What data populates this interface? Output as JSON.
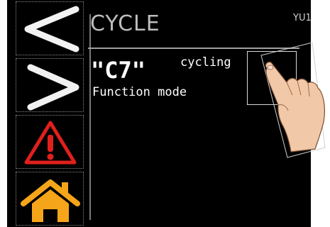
{
  "screen": {
    "title": "CYCLE",
    "code": "YU1",
    "alarm_code": "\"C7\"",
    "status": "cycling",
    "description": "Function mode"
  },
  "sidebar": {
    "buttons": [
      {
        "name": "previous",
        "icon": "chevron-left-icon"
      },
      {
        "name": "next",
        "icon": "chevron-right-icon"
      },
      {
        "name": "alarm",
        "icon": "warning-icon"
      },
      {
        "name": "home",
        "icon": "home-icon"
      }
    ]
  },
  "colors": {
    "warning": "#e0201c",
    "home": "#f5a51a",
    "background": "#000000"
  }
}
